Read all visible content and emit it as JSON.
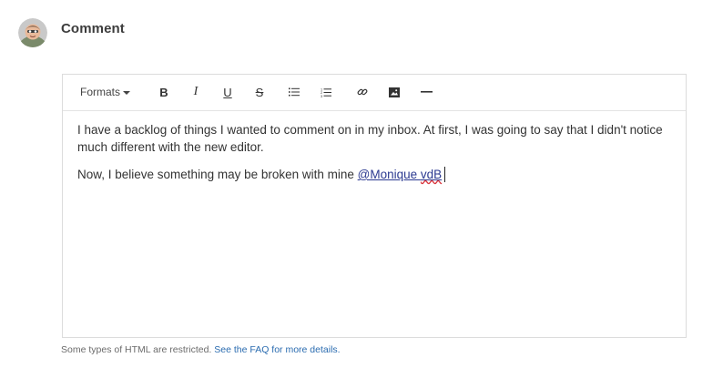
{
  "header": {
    "title": "Comment",
    "avatar_icon": "user-avatar"
  },
  "toolbar": {
    "formats_label": "Formats",
    "bold_label": "B",
    "italic_label": "I",
    "underline_label": "U",
    "strike_label": "S",
    "icons": [
      "bullet-list-icon",
      "numbered-list-icon",
      "link-icon",
      "image-icon",
      "horizontal-rule-icon"
    ]
  },
  "editor": {
    "paragraph1": "I have a backlog of things I wanted to comment on in my inbox.  At first, I was going to say that I didn't notice much different with the new editor.",
    "paragraph2_text": "Now, I believe something may be broken with mine ",
    "mention_prefix": "@Monique ",
    "mention_misspelled": "vdB"
  },
  "footer": {
    "note": "Some types of HTML are restricted. ",
    "faq_link": "See the FAQ for more details."
  },
  "colors": {
    "mention": "#2b3990",
    "link": "#2b6cb0",
    "spellcheck": "#d9363e"
  }
}
